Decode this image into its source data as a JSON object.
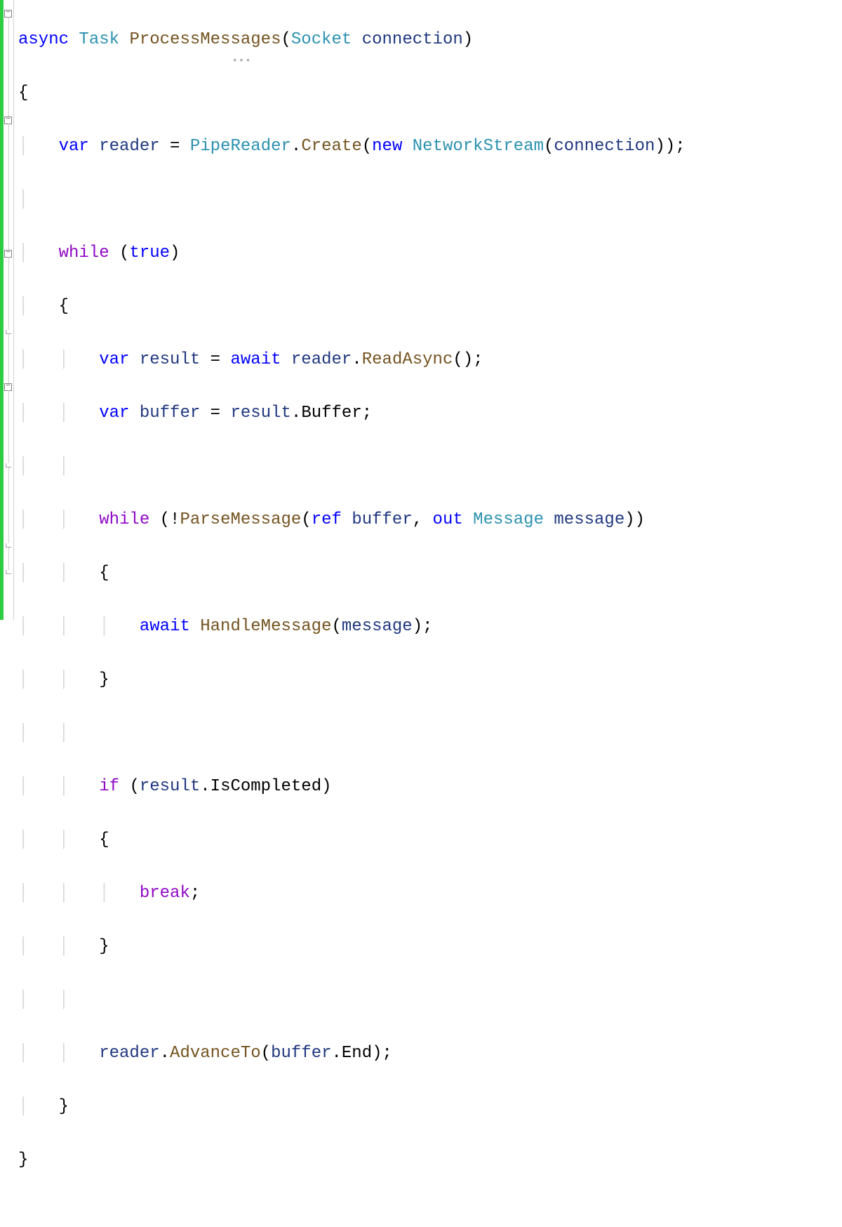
{
  "tokens": {
    "async": "async",
    "Task": "Task",
    "ProcessMessages": "ProcessMessages",
    "Socket": "Socket",
    "connection": "connection",
    "var": "var",
    "reader": "reader",
    "PipeReader": "PipeReader",
    "Create": "Create",
    "new": "new",
    "NetworkStream": "NetworkStream",
    "while": "while",
    "true": "true",
    "result": "result",
    "await": "await",
    "ReadAsync": "ReadAsync",
    "buffer": "buffer",
    "Buffer": "Buffer",
    "ParseMessage": "ParseMessage",
    "ref": "ref",
    "out": "out",
    "Message": "Message",
    "message": "message",
    "HandleMessage": "HandleMessage",
    "if": "if",
    "IsCompleted": "IsCompleted",
    "break": "break",
    "AdvanceTo": "AdvanceTo",
    "End": "End"
  },
  "punct": {
    "lparen": "(",
    "rparen": ")",
    "lbrace": "{",
    "rbrace": "}",
    "semi": ";",
    "dot": ".",
    "eq": " = ",
    "comma": ", ",
    "bang": "!",
    "empty": "()"
  }
}
